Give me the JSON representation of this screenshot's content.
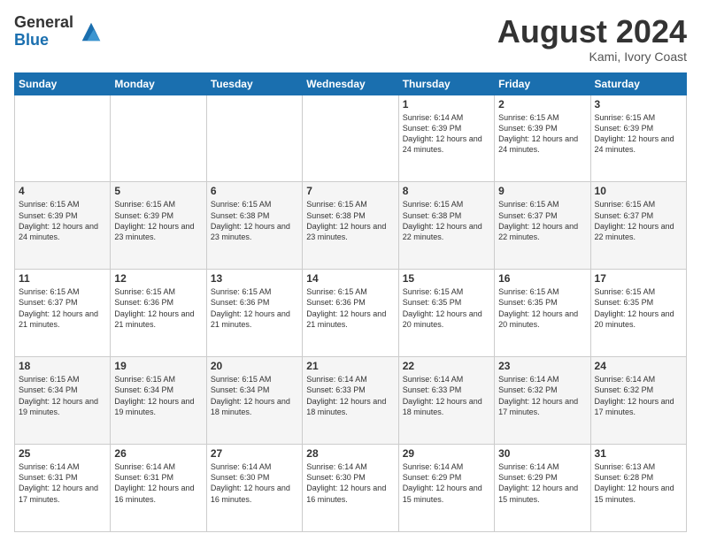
{
  "logo": {
    "general": "General",
    "blue": "Blue"
  },
  "header": {
    "month": "August 2024",
    "location": "Kami, Ivory Coast"
  },
  "days_of_week": [
    "Sunday",
    "Monday",
    "Tuesday",
    "Wednesday",
    "Thursday",
    "Friday",
    "Saturday"
  ],
  "weeks": [
    [
      {
        "day": "",
        "info": ""
      },
      {
        "day": "",
        "info": ""
      },
      {
        "day": "",
        "info": ""
      },
      {
        "day": "",
        "info": ""
      },
      {
        "day": "1",
        "info": "Sunrise: 6:14 AM\nSunset: 6:39 PM\nDaylight: 12 hours\nand 24 minutes."
      },
      {
        "day": "2",
        "info": "Sunrise: 6:15 AM\nSunset: 6:39 PM\nDaylight: 12 hours\nand 24 minutes."
      },
      {
        "day": "3",
        "info": "Sunrise: 6:15 AM\nSunset: 6:39 PM\nDaylight: 12 hours\nand 24 minutes."
      }
    ],
    [
      {
        "day": "4",
        "info": "Sunrise: 6:15 AM\nSunset: 6:39 PM\nDaylight: 12 hours\nand 24 minutes."
      },
      {
        "day": "5",
        "info": "Sunrise: 6:15 AM\nSunset: 6:39 PM\nDaylight: 12 hours\nand 23 minutes."
      },
      {
        "day": "6",
        "info": "Sunrise: 6:15 AM\nSunset: 6:38 PM\nDaylight: 12 hours\nand 23 minutes."
      },
      {
        "day": "7",
        "info": "Sunrise: 6:15 AM\nSunset: 6:38 PM\nDaylight: 12 hours\nand 23 minutes."
      },
      {
        "day": "8",
        "info": "Sunrise: 6:15 AM\nSunset: 6:38 PM\nDaylight: 12 hours\nand 22 minutes."
      },
      {
        "day": "9",
        "info": "Sunrise: 6:15 AM\nSunset: 6:37 PM\nDaylight: 12 hours\nand 22 minutes."
      },
      {
        "day": "10",
        "info": "Sunrise: 6:15 AM\nSunset: 6:37 PM\nDaylight: 12 hours\nand 22 minutes."
      }
    ],
    [
      {
        "day": "11",
        "info": "Sunrise: 6:15 AM\nSunset: 6:37 PM\nDaylight: 12 hours\nand 21 minutes."
      },
      {
        "day": "12",
        "info": "Sunrise: 6:15 AM\nSunset: 6:36 PM\nDaylight: 12 hours\nand 21 minutes."
      },
      {
        "day": "13",
        "info": "Sunrise: 6:15 AM\nSunset: 6:36 PM\nDaylight: 12 hours\nand 21 minutes."
      },
      {
        "day": "14",
        "info": "Sunrise: 6:15 AM\nSunset: 6:36 PM\nDaylight: 12 hours\nand 21 minutes."
      },
      {
        "day": "15",
        "info": "Sunrise: 6:15 AM\nSunset: 6:35 PM\nDaylight: 12 hours\nand 20 minutes."
      },
      {
        "day": "16",
        "info": "Sunrise: 6:15 AM\nSunset: 6:35 PM\nDaylight: 12 hours\nand 20 minutes."
      },
      {
        "day": "17",
        "info": "Sunrise: 6:15 AM\nSunset: 6:35 PM\nDaylight: 12 hours\nand 20 minutes."
      }
    ],
    [
      {
        "day": "18",
        "info": "Sunrise: 6:15 AM\nSunset: 6:34 PM\nDaylight: 12 hours\nand 19 minutes."
      },
      {
        "day": "19",
        "info": "Sunrise: 6:15 AM\nSunset: 6:34 PM\nDaylight: 12 hours\nand 19 minutes."
      },
      {
        "day": "20",
        "info": "Sunrise: 6:15 AM\nSunset: 6:34 PM\nDaylight: 12 hours\nand 18 minutes."
      },
      {
        "day": "21",
        "info": "Sunrise: 6:14 AM\nSunset: 6:33 PM\nDaylight: 12 hours\nand 18 minutes."
      },
      {
        "day": "22",
        "info": "Sunrise: 6:14 AM\nSunset: 6:33 PM\nDaylight: 12 hours\nand 18 minutes."
      },
      {
        "day": "23",
        "info": "Sunrise: 6:14 AM\nSunset: 6:32 PM\nDaylight: 12 hours\nand 17 minutes."
      },
      {
        "day": "24",
        "info": "Sunrise: 6:14 AM\nSunset: 6:32 PM\nDaylight: 12 hours\nand 17 minutes."
      }
    ],
    [
      {
        "day": "25",
        "info": "Sunrise: 6:14 AM\nSunset: 6:31 PM\nDaylight: 12 hours\nand 17 minutes."
      },
      {
        "day": "26",
        "info": "Sunrise: 6:14 AM\nSunset: 6:31 PM\nDaylight: 12 hours\nand 16 minutes."
      },
      {
        "day": "27",
        "info": "Sunrise: 6:14 AM\nSunset: 6:30 PM\nDaylight: 12 hours\nand 16 minutes."
      },
      {
        "day": "28",
        "info": "Sunrise: 6:14 AM\nSunset: 6:30 PM\nDaylight: 12 hours\nand 16 minutes."
      },
      {
        "day": "29",
        "info": "Sunrise: 6:14 AM\nSunset: 6:29 PM\nDaylight: 12 hours\nand 15 minutes."
      },
      {
        "day": "30",
        "info": "Sunrise: 6:14 AM\nSunset: 6:29 PM\nDaylight: 12 hours\nand 15 minutes."
      },
      {
        "day": "31",
        "info": "Sunrise: 6:13 AM\nSunset: 6:28 PM\nDaylight: 12 hours\nand 15 minutes."
      }
    ]
  ]
}
